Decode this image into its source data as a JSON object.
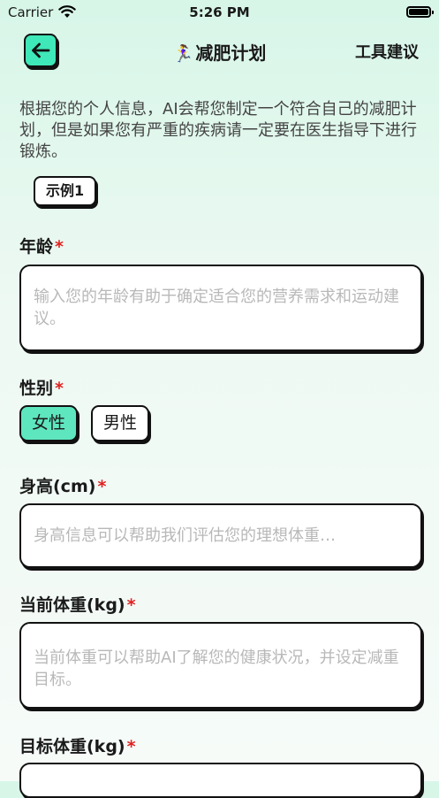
{
  "status_bar": {
    "carrier": "Carrier",
    "time": "5:26 PM"
  },
  "nav": {
    "title_emoji": "🏃‍♀️",
    "title": "减肥计划",
    "right_action": "工具建议"
  },
  "intro": "根据您的个人信息，AI会帮您制定一个符合自己的减肥计划，但是如果您有严重的疾病请一定要在医生指导下进行锻炼。",
  "example_button": "示例1",
  "form": {
    "age": {
      "label": "年龄",
      "required": "*",
      "placeholder": "输入您的年龄有助于确定适合您的营养需求和运动建议。"
    },
    "gender": {
      "label": "性别",
      "required": "*",
      "options": [
        "女性",
        "男性"
      ],
      "selected": "女性"
    },
    "height": {
      "label": "身高(cm)",
      "required": "*",
      "placeholder": "身高信息可以帮助我们评估您的理想体重…"
    },
    "current_weight": {
      "label": "当前体重(kg)",
      "required": "*",
      "placeholder": "当前体重可以帮助AI了解您的健康状况，并设定减重目标。"
    },
    "target_weight": {
      "label": "目标体重(kg)",
      "required": "*",
      "placeholder": ""
    }
  },
  "colors": {
    "accent": "#5ee6bf",
    "back_button": "#3fe8b8",
    "required": "#e02020"
  }
}
